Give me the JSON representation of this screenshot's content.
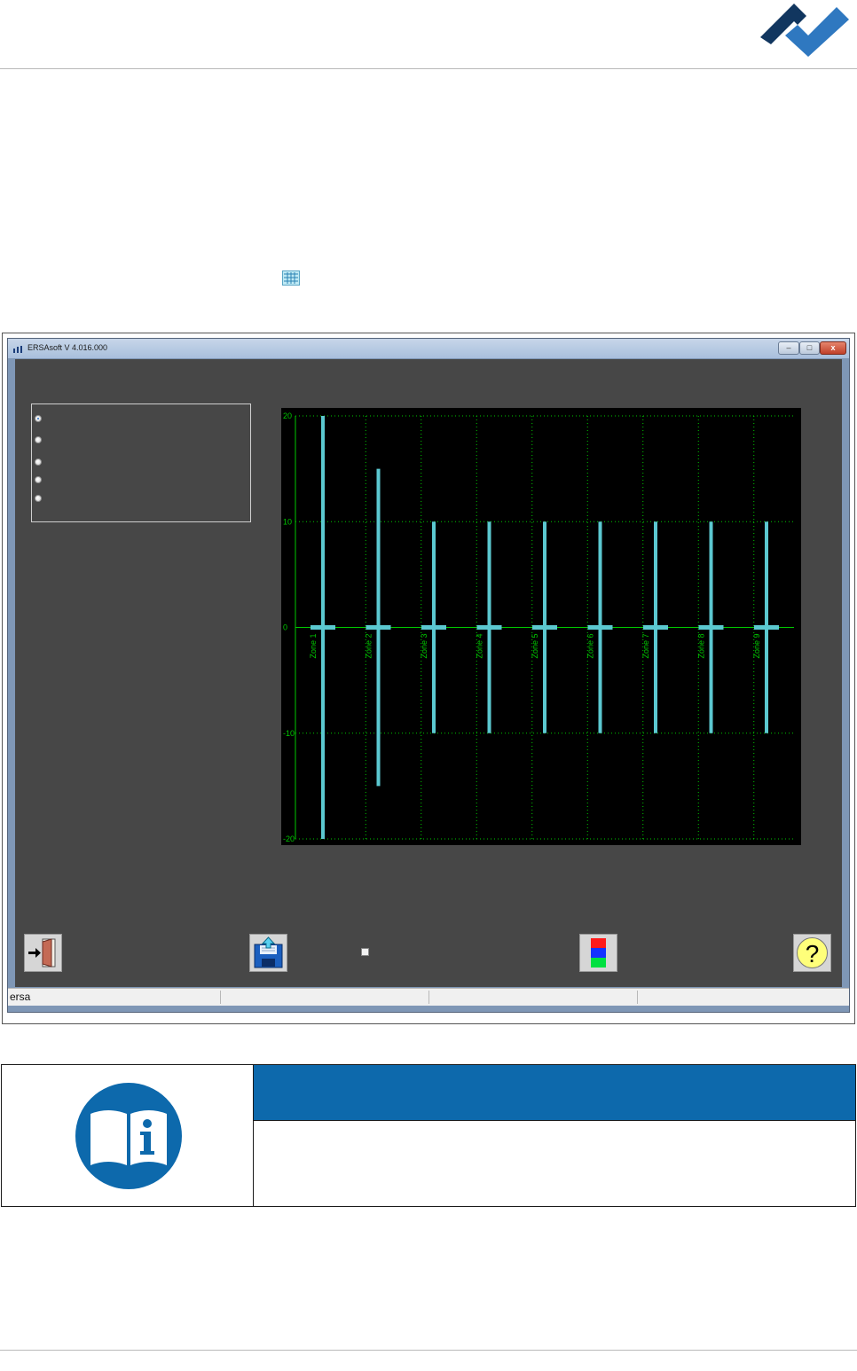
{
  "window": {
    "title": "ERSAsoft V 4.016.000",
    "buttons": {
      "minimize": "‒",
      "maximize": "□",
      "close": "x"
    }
  },
  "radio_options": {
    "selected_index": 0,
    "count": 5
  },
  "status_bar": {
    "cells": [
      "ersa",
      "",
      "",
      "",
      ""
    ]
  },
  "icons": {
    "logo": "brand-logo-icon",
    "grid_toolbar": "grid-view-icon",
    "exit": "exit-door-icon",
    "save": "save-upload-icon",
    "colors": "color-settings-icon",
    "help": "help-question-icon",
    "info": "read-manual-info-icon"
  },
  "colors": {
    "brand_dark": "#11365f",
    "brand_light": "#2f78c0",
    "chart_grid": "#00c800",
    "chart_bars": "#5bc8d0",
    "info_blue": "#0d69ac"
  },
  "chart_data": {
    "type": "bar",
    "categories": [
      "Zone 1",
      "Zone 2",
      "Zone 3",
      "Zone 4",
      "Zone 5",
      "Zone 6",
      "Zone 7",
      "Zone 8",
      "Zone 9"
    ],
    "upper": [
      20,
      15,
      10,
      10,
      10,
      10,
      10,
      10,
      10
    ],
    "lower": [
      -20,
      -15,
      -10,
      -10,
      -10,
      -10,
      -10,
      -10,
      -10
    ],
    "ylim": [
      -20,
      20
    ],
    "yticks": [
      20,
      10,
      0,
      -10,
      -20
    ],
    "grid": true
  }
}
